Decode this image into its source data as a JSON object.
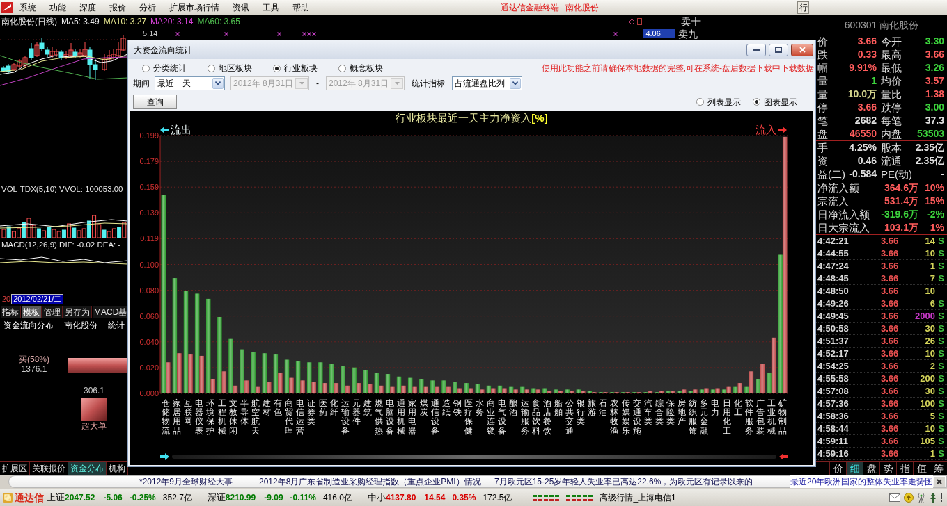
{
  "menu_bar": {
    "items": [
      "系统",
      "功能",
      "深度",
      "报价",
      "分析",
      "扩展市场行情",
      "资讯",
      "工具",
      "帮助"
    ],
    "title": "通达信金融终端",
    "stock": "南化股份",
    "button": "行"
  },
  "kline_panel": {
    "title": "南化股份(日线)",
    "indicators": [
      {
        "label": "MA5: 3.49",
        "color": "#e8e8e8"
      },
      {
        "label": "MA10: 3.27",
        "color": "#e8e890"
      },
      {
        "label": "MA20: 3.14",
        "color": "#d040d0"
      },
      {
        "label": "MA60: 3.65",
        "color": "#50c050"
      }
    ],
    "order_book": [
      "卖十",
      "卖九"
    ],
    "high_price": "5.14",
    "price_tag": "4.06",
    "volume_label": "VOL-TDX(5,10) VVOL: 100053.00",
    "macd_label": "MACD(12,26,9) DIF: -0.02 DEA: -",
    "date_prefix": "20",
    "date": "2012/02/21/二",
    "tabs": [
      {
        "label": "指标",
        "selected": false
      },
      {
        "label": "模板",
        "selected": true
      },
      {
        "label": "管理",
        "selected": false
      },
      {
        "label": "另存为",
        "selected": false
      },
      {
        "label": "MACD基",
        "selected": false
      }
    ],
    "fund_tabs": [
      "资金流向分布",
      "南化股份",
      "统计"
    ],
    "buy": {
      "label": "买(58%)",
      "value": "1376.1"
    },
    "super_large": {
      "value": "306.1",
      "label": "超大单"
    }
  },
  "quote_panel": {
    "header": "600301 南化股份",
    "sections": [
      {
        "rows": [
          [
            {
              "label": "价",
              "value": "3.66",
              "color": "#ff5c5c"
            },
            {
              "label": "今开",
              "value": "3.30",
              "color": "#3cd23c"
            }
          ],
          [
            {
              "label": "跌",
              "value": "0.33",
              "color": "#ff5c5c"
            },
            {
              "label": "最高",
              "value": "3.66",
              "color": "#ff5c5c"
            }
          ],
          [
            {
              "label": "幅",
              "value": "9.91%",
              "color": "#ff5c5c"
            },
            {
              "label": "最低",
              "value": "3.26",
              "color": "#3cd23c"
            }
          ],
          [
            {
              "label": "量",
              "value": "1",
              "color": "#3cd23c"
            },
            {
              "label": "均价",
              "value": "3.57",
              "color": "#ff5c5c"
            }
          ],
          [
            {
              "label": "量",
              "value": "10.0万",
              "color": "#d4d48c"
            },
            {
              "label": "量比",
              "value": "1.38",
              "color": "#ff5c5c"
            }
          ],
          [
            {
              "label": "停",
              "value": "3.66",
              "color": "#ff5c5c"
            },
            {
              "label": "跌停",
              "value": "3.00",
              "color": "#3cd23c"
            }
          ],
          [
            {
              "label": "笔",
              "value": "2682",
              "color": "#e0e0e0"
            },
            {
              "label": "每笔",
              "value": "37.3",
              "color": "#e0e0e0"
            }
          ],
          [
            {
              "label": "盘",
              "value": "46550",
              "color": "#ff5c5c"
            },
            {
              "label": "内盘",
              "value": "53503",
              "color": "#3cd23c"
            }
          ]
        ]
      },
      {
        "rows": [
          [
            {
              "label": "手",
              "value": "4.25%",
              "color": "#e0e0e0"
            },
            {
              "label": "股本",
              "value": "2.35亿",
              "color": "#e0e0e0"
            }
          ],
          [
            {
              "label": "资",
              "value": "0.46",
              "color": "#e0e0e0"
            },
            {
              "label": "流通",
              "value": "2.35亿",
              "color": "#e0e0e0"
            }
          ],
          [
            {
              "label": "益(二)",
              "value": "-0.584",
              "color": "#e0e0e0"
            },
            {
              "label": "PE(动)",
              "value": "-",
              "color": "#e0e0e0"
            }
          ]
        ]
      }
    ],
    "fund_flows": [
      {
        "label": "净流入额",
        "value": "364.6万",
        "percent": "10%",
        "color": "#ff5c5c"
      },
      {
        "label": "宗流入",
        "value": "531.4万",
        "percent": "15%",
        "color": "#ff5c5c"
      },
      {
        "label": "日净流入额",
        "value": "-319.6万",
        "percent": "-2%",
        "color": "#3cd23c"
      },
      {
        "label": "日大宗流入",
        "value": "103.1万",
        "percent": "1%",
        "color": "#ff5c5c"
      }
    ],
    "ticks": [
      {
        "time": "4:42:21",
        "price": "3.66",
        "volume": "14",
        "color": "#d4d45a",
        "side": "S"
      },
      {
        "time": "4:44:55",
        "price": "3.66",
        "volume": "10",
        "color": "#d4d45a",
        "side": "S"
      },
      {
        "time": "4:47:24",
        "price": "3.66",
        "volume": "1",
        "color": "#d4d45a",
        "side": "S"
      },
      {
        "time": "4:48:45",
        "price": "3.66",
        "volume": "7",
        "color": "#d4d45a",
        "side": "S"
      },
      {
        "time": "4:48:50",
        "price": "3.66",
        "volume": "10",
        "color": "#d4d45a"
      },
      {
        "time": "4:49:26",
        "price": "3.66",
        "volume": "6",
        "color": "#d4d45a",
        "side": "S"
      },
      {
        "time": "4:49:45",
        "price": "3.66",
        "volume": "2000",
        "color": "#c838c8",
        "side": "S"
      },
      {
        "time": "4:50:58",
        "price": "3.66",
        "volume": "30",
        "color": "#d4d45a",
        "side": "S"
      },
      {
        "time": "4:51:37",
        "price": "3.66",
        "volume": "26",
        "color": "#d4d45a",
        "side": "S"
      },
      {
        "time": "4:52:17",
        "price": "3.66",
        "volume": "10",
        "color": "#d4d45a",
        "side": "S"
      },
      {
        "time": "4:54:25",
        "price": "3.66",
        "volume": "2",
        "color": "#d4d45a",
        "side": "S"
      },
      {
        "time": "4:55:58",
        "price": "3.66",
        "volume": "200",
        "color": "#d4d45a",
        "side": "S"
      },
      {
        "time": "4:57:08",
        "price": "3.66",
        "volume": "30",
        "color": "#d4d45a",
        "side": "S"
      },
      {
        "time": "4:57:36",
        "price": "3.66",
        "volume": "100",
        "color": "#d4d45a",
        "side": "S"
      },
      {
        "time": "4:58:36",
        "price": "3.66",
        "volume": "5",
        "color": "#d4d45a",
        "side": "S"
      },
      {
        "time": "4:58:44",
        "price": "3.66",
        "volume": "10",
        "color": "#d4d45a",
        "side": "S"
      },
      {
        "time": "4:59:11",
        "price": "3.66",
        "volume": "105",
        "color": "#d4d45a",
        "side": "S"
      },
      {
        "time": "4:59:16",
        "price": "3.66",
        "volume": "1",
        "color": "#d4d45a",
        "side": "S"
      }
    ]
  },
  "dialog": {
    "title": "大资金流向统计",
    "scope_options": [
      {
        "label": "分类统计",
        "selected": false
      },
      {
        "label": "地区板块",
        "selected": false
      },
      {
        "label": "行业板块",
        "selected": true
      },
      {
        "label": "概念板块",
        "selected": false
      }
    ],
    "notice": "使用此功能之前请确保本地数据的完整,可在系统-盘后数据下载中下载数据",
    "period_label": "期间",
    "period": "最近一天",
    "start_date": {
      "value": "2012年 8月31日",
      "disabled": true
    },
    "separator": "-",
    "end_date": {
      "value": "2012年 8月31日",
      "disabled": true
    },
    "metric_label": "统计指标",
    "metric": "占流通盘比列",
    "query_button": "查询",
    "view_options": [
      {
        "label": "列表显示",
        "selected": false
      },
      {
        "label": "图表显示",
        "selected": true
      }
    ],
    "chart": {
      "outflow_label": "流出",
      "inflow_label": "流入",
      "chart_data": {
        "type": "bar",
        "title": "行业板块最近一天主力净资入**[%]**",
        "categories": [
          "仓储物流",
          "家居用品",
          "互联网",
          "电器仪表",
          "环境保护",
          "工程机械",
          "文教休闲",
          "半导体",
          "航空航天",
          "建材",
          "有色",
          "商贸代理",
          "电信运营",
          "证券类",
          "医药",
          "化纤",
          "运输设备",
          "元器件",
          "建筑",
          "燃气供热",
          "电脑设备",
          "通用机械",
          "家用电器",
          "煤炭",
          "通信设备",
          "造纸",
          "钢铁",
          "医疗保健",
          "水务",
          "商业连锁",
          "电气设备",
          "酿酒",
          "运输服务",
          "食品饮料",
          "酒店餐饮",
          "船舶",
          "公共交通",
          "银行类",
          "旅游",
          "石油",
          "农林牧渔",
          "传媒娱乐",
          "交通设施",
          "汽车类",
          "综合类",
          "保险类",
          "房地产",
          "纺织服饰",
          "多元金融",
          "电力",
          "日用化工",
          "化工",
          "软件服务",
          "广告包装",
          "工业机械",
          "矿物制品"
        ],
        "series": [
          {
            "color": "#2e9e2e",
            "values": [
              0.153,
              0.089,
              0.079,
              0.077,
              0.073,
              0.059,
              0.042,
              0.034,
              0.032,
              0.031,
              0.03,
              0.026,
              0.025,
              0.024,
              0.024,
              0.023,
              0.021,
              0.02,
              0.018,
              0.016,
              0.015,
              0.013,
              0.012,
              0.011,
              0.01,
              0.01,
              0.009,
              0.008,
              0.007,
              0.006,
              0.006,
              0.005,
              0.005,
              0.004,
              0.004,
              0.003,
              0.003,
              0.003,
              0.002,
              0.001,
              0.001,
              0.001,
              0.001,
              0.001,
              0.001,
              0.002,
              0.002,
              0.002,
              0.003,
              0.003,
              0.003,
              0.005,
              0.005,
              0.011,
              0.016,
              0.107
            ]
          },
          {
            "color": "#c04848",
            "values": [
              0.024,
              0.031,
              0.03,
              0.029,
              0.011,
              0.017,
              0.006,
              0.01,
              0.005,
              0.009,
              0.016,
              0.012,
              0.01,
              0.009,
              0.008,
              0.008,
              0.006,
              0.008,
              0.007,
              0.006,
              0.005,
              0.006,
              0.005,
              0.005,
              0.005,
              0.005,
              0.004,
              0.004,
              0.003,
              0.004,
              0.004,
              0.003,
              0.003,
              0.003,
              0.002,
              0.002,
              0.002,
              0.002,
              0.001,
              0.001,
              0.001,
              0.001,
              0.001,
              0.002,
              0.002,
              0.002,
              0.003,
              0.003,
              0.004,
              0.004,
              0.005,
              0.008,
              0.017,
              0.023,
              0.043,
              0.198
            ]
          }
        ],
        "ylim": [
          0,
          0.199
        ],
        "yticks": [
          {
            "value": 0,
            "label": "0.000"
          },
          {
            "value": 0.0199,
            "label": "0.020"
          },
          {
            "value": 0.0398,
            "label": "0.040"
          },
          {
            "value": 0.0597,
            "label": "0.060"
          },
          {
            "value": 0.0796,
            "label": "0.080"
          },
          {
            "value": 0.0995,
            "label": "0.100"
          },
          {
            "value": 0.1194,
            "label": "0.119"
          },
          {
            "value": 0.1393,
            "label": "0.139"
          },
          {
            "value": 0.1592,
            "label": "0.159"
          },
          {
            "value": 0.1791,
            "label": "0.179"
          },
          {
            "value": 0.199,
            "label": "0.199"
          }
        ],
        "stacked": false,
        "grid": true
      }
    }
  },
  "bottom_tabs": [
    {
      "label": "扩展区",
      "selected": false
    },
    {
      "label": "关联报价",
      "selected": false
    },
    {
      "label": "资金分布",
      "selected": true
    },
    {
      "label": "机构",
      "selected": false
    }
  ],
  "quote_tabs": [
    {
      "label": "价",
      "selected": false
    },
    {
      "label": "细",
      "selected": true
    },
    {
      "label": "盘",
      "selected": false
    },
    {
      "label": "势",
      "selected": false
    },
    {
      "label": "指",
      "selected": false
    },
    {
      "label": "值",
      "selected": false
    },
    {
      "label": "筹",
      "selected": false
    }
  ],
  "news_ticker": {
    "items": [
      {
        "text": "*2012年9月全球财经大事",
        "highlighted": false
      },
      {
        "text": "2012年8月广东省制造业采购经理指数（重点企业PMI）情况",
        "highlighted": false
      },
      {
        "text": "7月欧元区15-25岁年轻人失业率已高达22.6%，为欧元区有记录以来的",
        "highlighted": false
      },
      {
        "text": "最近20年欧洲国家的整体失业率走势图",
        "highlighted": true
      }
    ]
  },
  "status_bar": {
    "brand": "通达信",
    "indices": [
      {
        "name": "上证",
        "value": "2047.52",
        "change": "-5.06",
        "percent": "-0.25%",
        "amount": "352.7亿",
        "color": "#007a00"
      },
      {
        "name": "深证",
        "value": "8210.99",
        "change": "-9.09",
        "percent": "-0.11%",
        "amount": "416.0亿",
        "color": "#007a00"
      },
      {
        "name": "中小",
        "value": "4137.80",
        "change": "14.54",
        "percent": "0.35%",
        "amount": "172.5亿",
        "color": "#d80000"
      }
    ],
    "server": "高级行情_上海电信1"
  }
}
